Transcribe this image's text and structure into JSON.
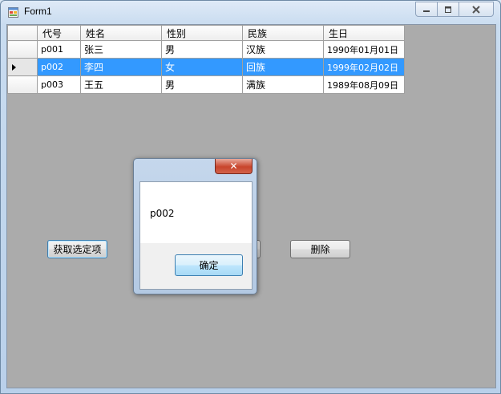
{
  "window": {
    "title": "Form1"
  },
  "grid": {
    "columns": [
      "代号",
      "姓名",
      "性别",
      "民族",
      "生日"
    ],
    "rows": [
      [
        "p001",
        "张三",
        "男",
        "汉族",
        "1990年01月01日"
      ],
      [
        "p002",
        "李四",
        "女",
        "回族",
        "1999年02月02日"
      ],
      [
        "p003",
        "王五",
        "男",
        "满族",
        "1989年08月09日"
      ]
    ],
    "selected_row": 1
  },
  "buttons": {
    "get_selected": "获取选定项",
    "delete": "删除"
  },
  "dialog": {
    "message": "p002",
    "ok_label": "确定",
    "close_glyph": "✕"
  },
  "colors": {
    "selection": "#3399ff",
    "client_background": "#ababab"
  }
}
